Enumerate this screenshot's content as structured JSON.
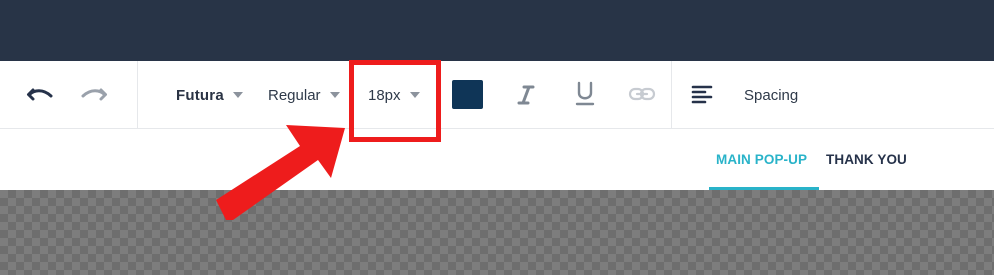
{
  "toolbar": {
    "font_family": "Futura",
    "font_weight": "Regular",
    "font_size": "18px",
    "text_color": "#0f3557",
    "spacing_label": "Spacing",
    "icons": [
      "undo-icon",
      "redo-icon",
      "italic-icon",
      "underline-icon",
      "link-icon",
      "align-left-icon"
    ]
  },
  "tabs": {
    "main_popup": "MAIN POP-UP",
    "thank_you": "THANK YOU",
    "active": "MAIN POP-UP"
  },
  "colors": {
    "topbar": "#283447",
    "accent": "#29b3c9",
    "annotation": "#ee1c1c"
  },
  "annotation": {
    "highlighted": "font-size-dropdown"
  }
}
